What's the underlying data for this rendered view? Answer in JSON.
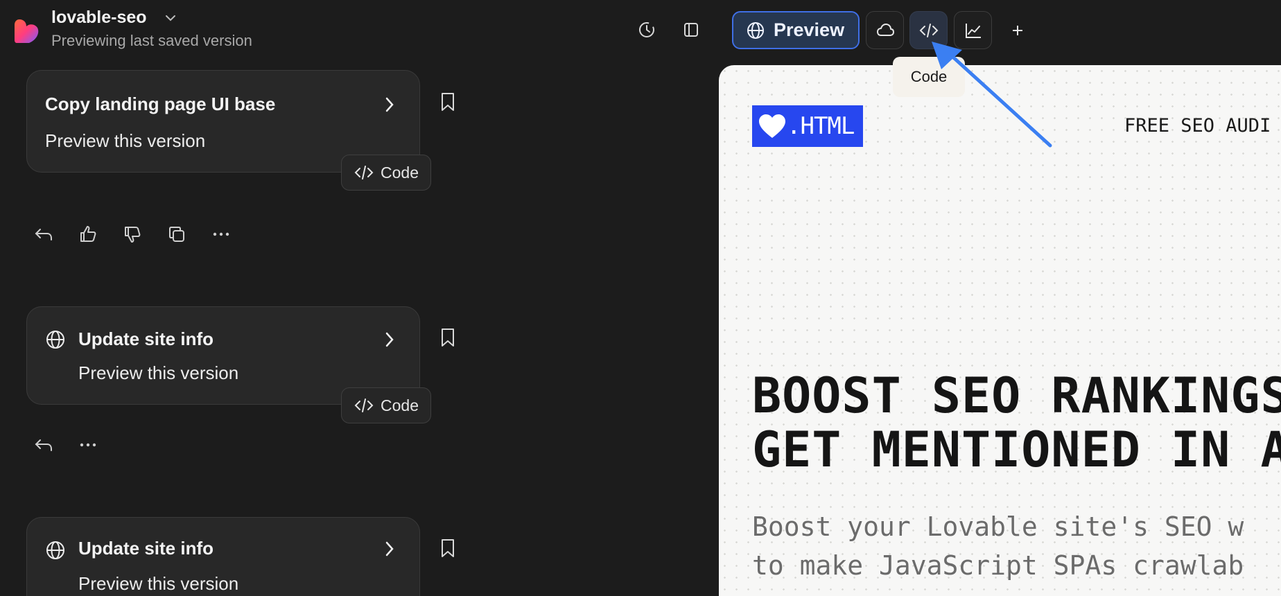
{
  "project": {
    "name": "lovable-seo",
    "subtitle": "Previewing last saved version"
  },
  "toolbar": {
    "preview_label": "Preview",
    "tooltip": "Code",
    "icons": [
      "history-icon",
      "sidebar-icon",
      "globe-icon",
      "cloud-icon",
      "code-icon",
      "chart-icon",
      "plus-icon"
    ]
  },
  "versions": [
    {
      "title": "Copy landing page UI base",
      "subtitle": "Preview this version",
      "code_label": "Code"
    },
    {
      "title": "Update site info",
      "subtitle": "Preview this version",
      "code_label": "Code"
    },
    {
      "title": "Update site info",
      "subtitle": "Preview this version"
    }
  ],
  "preview_site": {
    "logo_text": ".HTML",
    "nav_text": "FREE SEO AUDI",
    "hero_line1": "BOOST SEO RANKINGS",
    "hero_line2": "GET MENTIONED IN A",
    "hero_sub1": "Boost your Lovable site's SEO w",
    "hero_sub2": "to make JavaScript SPAs crawlab"
  },
  "colors": {
    "accent": "#3f6fe6",
    "site_brand": "#2747ef",
    "annotation_arrow": "#3b7ff2"
  }
}
